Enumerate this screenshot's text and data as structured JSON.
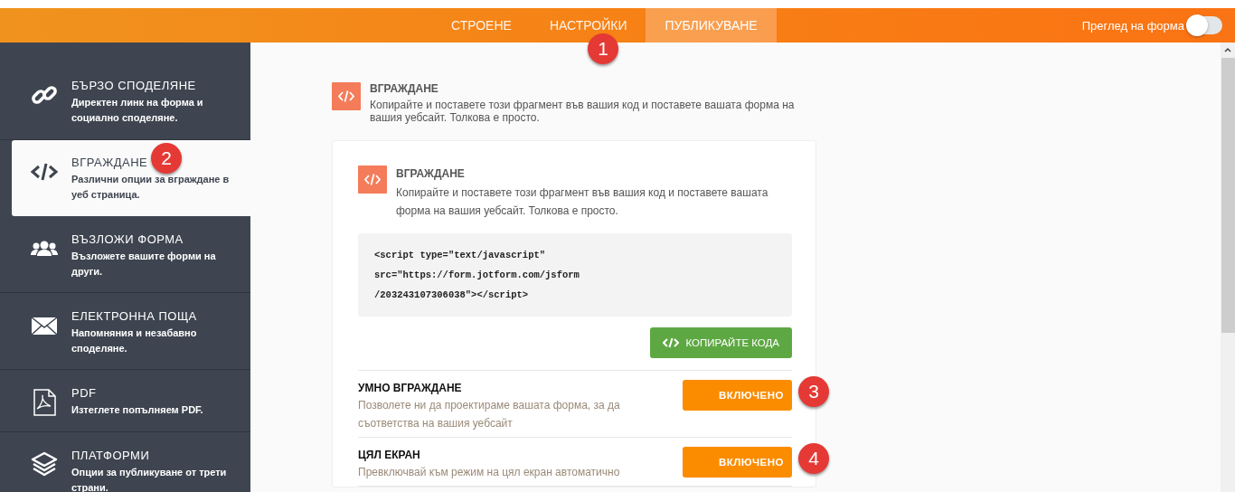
{
  "topbar": {
    "tabs": [
      {
        "label": "СТРОЕНЕ",
        "selected": false
      },
      {
        "label": "НАСТРОЙКИ",
        "selected": false,
        "badge": "1"
      },
      {
        "label": "ПУБЛИКУВАНЕ",
        "selected": true
      }
    ],
    "preview": {
      "label": "Преглед на форма",
      "on": false
    }
  },
  "sidebar": {
    "items": [
      {
        "kind": "link",
        "title": "БЪРЗО СПОДЕЛЯНЕ",
        "description": "Директен линк на форма и социално споделяне.",
        "selected": false
      },
      {
        "kind": "embed",
        "title": "ВГРАЖДАНЕ",
        "description": "Различни опции за вграждане в уеб страница.",
        "selected": true,
        "badge": "2"
      },
      {
        "kind": "people",
        "title": "ВЪЗЛОЖИ ФОРМА",
        "description": "Възложете вашите форми на други.",
        "selected": false
      },
      {
        "kind": "mail",
        "title": "ЕЛЕКТРОННА ПОЩА",
        "description": "Напомняния и незабавно споделяне.",
        "selected": false
      },
      {
        "kind": "pdf",
        "title": "PDF",
        "description": "Изтеглете попълняем PDF.",
        "selected": false
      },
      {
        "kind": "layers",
        "title": "ПЛАТФОРМИ",
        "description": "Опции за публикуване от трети страни.",
        "selected": false
      }
    ]
  },
  "header": {
    "title": "ВГРАЖДАНЕ",
    "description": "Копирайте и поставете този фрагмент във вашия код и поставете вашата форма на вашия уебсайт. Толкова е просто."
  },
  "card": {
    "title": "ВГРАЖДАНЕ",
    "description": "Копирайте и поставете този фрагмент във вашия код и поставете вашата форма на вашия уебсайт. Толкова е просто.",
    "code_lines": [
      "<script type=\"text/javascript\"",
      "src=\"https://form.jotform.com/jsform",
      "/203243107306038\"></script>"
    ],
    "copy_button": "КОПИРАЙТЕ КОДА",
    "options": [
      {
        "title": "УМНО ВГРАЖДАНЕ",
        "description": "Позволете ни да проектираме вашата форма, за да съответства на вашия уебсайт",
        "toggle": "ВКЛЮЧЕНО",
        "on": true,
        "badge": "3"
      },
      {
        "title": "ЦЯЛ ЕКРАН",
        "description": "Превключвай към режим на цял екран автоматично",
        "toggle": "ВКЛЮЧЕНО",
        "on": true,
        "badge": "4"
      }
    ]
  }
}
